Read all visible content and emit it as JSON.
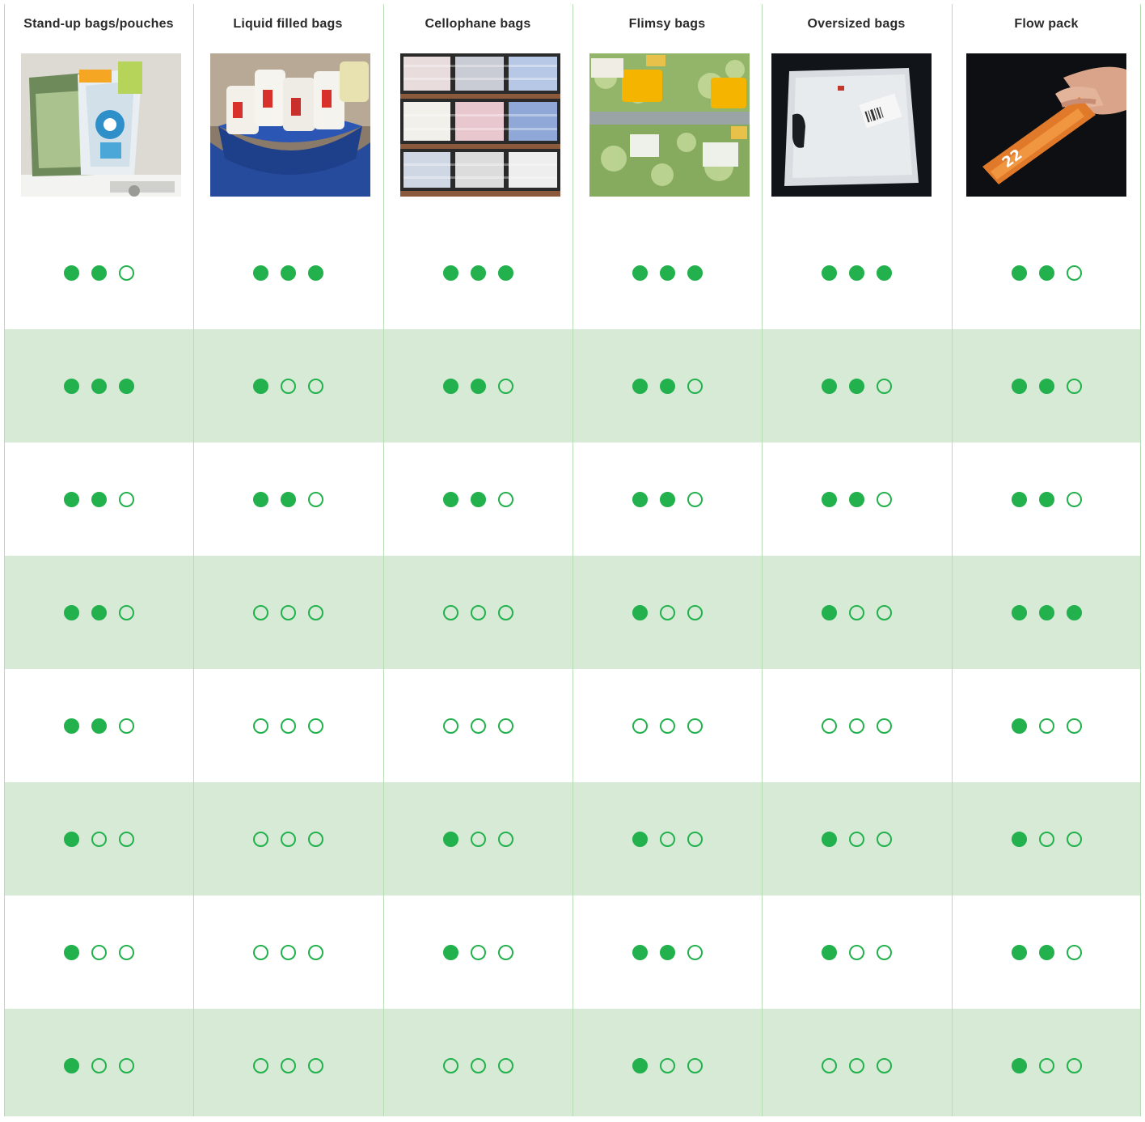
{
  "colors": {
    "accent": "#22b14c",
    "band": "#d6ead6",
    "divider": "#b7ddb5"
  },
  "max_rating": 3,
  "columns": [
    {
      "title": "Stand-up bags/pouches",
      "image": "stand-up-pouches-photo",
      "ratings": [
        2,
        3,
        2,
        2,
        2,
        1,
        1,
        1
      ]
    },
    {
      "title": "Liquid filled bags",
      "image": "liquid-filled-bags-photo",
      "ratings": [
        3,
        1,
        2,
        0,
        0,
        0,
        0,
        0
      ]
    },
    {
      "title": "Cellophane bags",
      "image": "cellophane-bags-photo",
      "ratings": [
        3,
        2,
        2,
        0,
        0,
        1,
        1,
        0
      ]
    },
    {
      "title": "Flimsy bags",
      "image": "flimsy-bags-photo",
      "ratings": [
        3,
        2,
        2,
        1,
        0,
        1,
        2,
        1
      ]
    },
    {
      "title": "Oversized bags",
      "image": "oversized-bags-photo",
      "ratings": [
        3,
        2,
        2,
        1,
        0,
        1,
        1,
        0
      ]
    },
    {
      "title": "Flow pack",
      "image": "flow-pack-photo",
      "ratings": [
        2,
        2,
        2,
        3,
        1,
        1,
        2,
        1
      ]
    }
  ]
}
